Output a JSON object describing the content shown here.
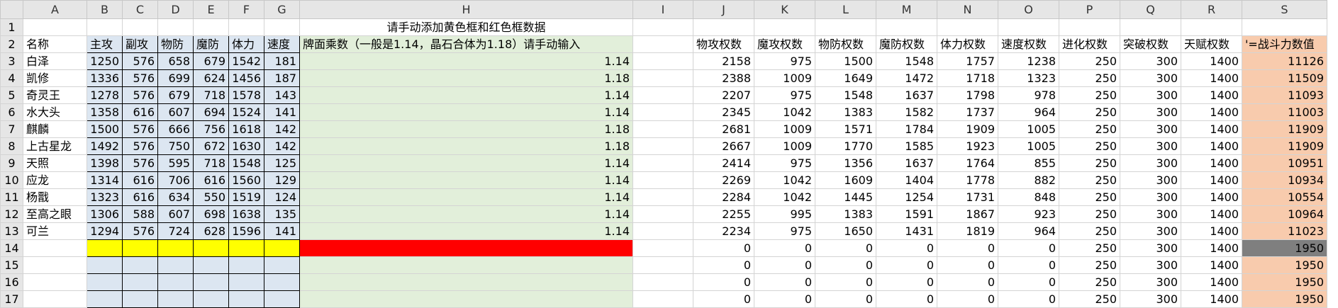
{
  "columns": [
    "A",
    "B",
    "C",
    "D",
    "E",
    "F",
    "G",
    "H",
    "I",
    "J",
    "K",
    "L",
    "M",
    "N",
    "O",
    "P",
    "Q",
    "R",
    "S"
  ],
  "rows": [
    1,
    2,
    3,
    4,
    5,
    6,
    7,
    8,
    9,
    10,
    11,
    12,
    13,
    14,
    15,
    16,
    17
  ],
  "title": "请手动添加黄色框和红色框数据",
  "header_row": {
    "A": "名称",
    "B": "主攻",
    "C": "副攻",
    "D": "物防",
    "E": "魔防",
    "F": "体力",
    "G": "速度",
    "H": "牌面乘数（一般是1.14，晶石合体为1.18）请手动输入",
    "J": "物攻权数",
    "K": "魔攻权数",
    "L": "物防权数",
    "M": "魔防权数",
    "N": "体力权数",
    "O": "速度权数",
    "P": "进化权数",
    "Q": "突破权数",
    "R": "天赋权数",
    "S": "'=战斗力数值"
  },
  "data_rows": [
    {
      "A": "白泽",
      "B": "1250",
      "C": "576",
      "D": "658",
      "E": "679",
      "F": "1542",
      "G": "181",
      "H": "1.14",
      "J": "2158",
      "K": "975",
      "L": "1500",
      "M": "1548",
      "N": "1757",
      "O": "1238",
      "P": "250",
      "Q": "300",
      "R": "1400",
      "S": "11126"
    },
    {
      "A": "凯修",
      "B": "1336",
      "C": "576",
      "D": "699",
      "E": "624",
      "F": "1456",
      "G": "187",
      "H": "1.18",
      "J": "2388",
      "K": "1009",
      "L": "1649",
      "M": "1472",
      "N": "1718",
      "O": "1323",
      "P": "250",
      "Q": "300",
      "R": "1400",
      "S": "11509"
    },
    {
      "A": "奇灵王",
      "B": "1278",
      "C": "576",
      "D": "679",
      "E": "718",
      "F": "1578",
      "G": "143",
      "H": "1.14",
      "J": "2207",
      "K": "975",
      "L": "1548",
      "M": "1637",
      "N": "1798",
      "O": "978",
      "P": "250",
      "Q": "300",
      "R": "1400",
      "S": "11093"
    },
    {
      "A": "水大头",
      "B": "1358",
      "C": "616",
      "D": "607",
      "E": "694",
      "F": "1524",
      "G": "141",
      "H": "1.14",
      "J": "2345",
      "K": "1042",
      "L": "1383",
      "M": "1582",
      "N": "1737",
      "O": "964",
      "P": "250",
      "Q": "300",
      "R": "1400",
      "S": "11003"
    },
    {
      "A": "麒麟",
      "B": "1500",
      "C": "576",
      "D": "666",
      "E": "756",
      "F": "1618",
      "G": "142",
      "H": "1.18",
      "J": "2681",
      "K": "1009",
      "L": "1571",
      "M": "1784",
      "N": "1909",
      "O": "1005",
      "P": "250",
      "Q": "300",
      "R": "1400",
      "S": "11909"
    },
    {
      "A": "上古星龙",
      "B": "1492",
      "C": "576",
      "D": "750",
      "E": "672",
      "F": "1630",
      "G": "142",
      "H": "1.18",
      "J": "2667",
      "K": "1009",
      "L": "1770",
      "M": "1585",
      "N": "1923",
      "O": "1005",
      "P": "250",
      "Q": "300",
      "R": "1400",
      "S": "11909"
    },
    {
      "A": "天照",
      "B": "1398",
      "C": "576",
      "D": "595",
      "E": "718",
      "F": "1548",
      "G": "125",
      "H": "1.14",
      "J": "2414",
      "K": "975",
      "L": "1356",
      "M": "1637",
      "N": "1764",
      "O": "855",
      "P": "250",
      "Q": "300",
      "R": "1400",
      "S": "10951"
    },
    {
      "A": "应龙",
      "B": "1314",
      "C": "616",
      "D": "706",
      "E": "616",
      "F": "1560",
      "G": "129",
      "H": "1.14",
      "J": "2269",
      "K": "1042",
      "L": "1609",
      "M": "1404",
      "N": "1778",
      "O": "882",
      "P": "250",
      "Q": "300",
      "R": "1400",
      "S": "10934"
    },
    {
      "A": "杨戬",
      "B": "1323",
      "C": "616",
      "D": "634",
      "E": "550",
      "F": "1519",
      "G": "124",
      "H": "1.14",
      "J": "2284",
      "K": "1042",
      "L": "1445",
      "M": "1254",
      "N": "1731",
      "O": "848",
      "P": "250",
      "Q": "300",
      "R": "1400",
      "S": "10554"
    },
    {
      "A": "至高之眼",
      "B": "1306",
      "C": "588",
      "D": "607",
      "E": "698",
      "F": "1638",
      "G": "135",
      "H": "1.14",
      "J": "2255",
      "K": "995",
      "L": "1383",
      "M": "1591",
      "N": "1867",
      "O": "923",
      "P": "250",
      "Q": "300",
      "R": "1400",
      "S": "10964"
    },
    {
      "A": "可兰",
      "B": "1294",
      "C": "576",
      "D": "724",
      "E": "628",
      "F": "1596",
      "G": "141",
      "H": "1.14",
      "J": "2234",
      "K": "975",
      "L": "1650",
      "M": "1431",
      "N": "1819",
      "O": "964",
      "P": "250",
      "Q": "300",
      "R": "1400",
      "S": "11023"
    },
    {
      "A": "",
      "B": "",
      "C": "",
      "D": "",
      "E": "",
      "F": "",
      "G": "",
      "H": "",
      "J": "0",
      "K": "0",
      "L": "0",
      "M": "0",
      "N": "0",
      "O": "0",
      "P": "250",
      "Q": "300",
      "R": "1400",
      "S": "1950"
    },
    {
      "A": "",
      "B": "",
      "C": "",
      "D": "",
      "E": "",
      "F": "",
      "G": "",
      "H": "",
      "J": "0",
      "K": "0",
      "L": "0",
      "M": "0",
      "N": "0",
      "O": "0",
      "P": "250",
      "Q": "300",
      "R": "1400",
      "S": "1950"
    },
    {
      "A": "",
      "B": "",
      "C": "",
      "D": "",
      "E": "",
      "F": "",
      "G": "",
      "H": "",
      "J": "0",
      "K": "0",
      "L": "0",
      "M": "0",
      "N": "0",
      "O": "0",
      "P": "250",
      "Q": "300",
      "R": "1400",
      "S": "1950"
    },
    {
      "A": "",
      "B": "",
      "C": "",
      "D": "",
      "E": "",
      "F": "",
      "G": "",
      "H": "",
      "J": "0",
      "K": "0",
      "L": "0",
      "M": "0",
      "N": "0",
      "O": "0",
      "P": "250",
      "Q": "300",
      "R": "1400",
      "S": "1950"
    }
  ],
  "colors": {
    "stat_fill": "#dce6f1",
    "multiplier_fill": "#e2efda",
    "result_fill": "#f8cbad",
    "input_yellow": "#ffff00",
    "input_red": "#ff0000",
    "selected_result": "#7f7f7f",
    "header_gray": "#e6e6e6"
  }
}
